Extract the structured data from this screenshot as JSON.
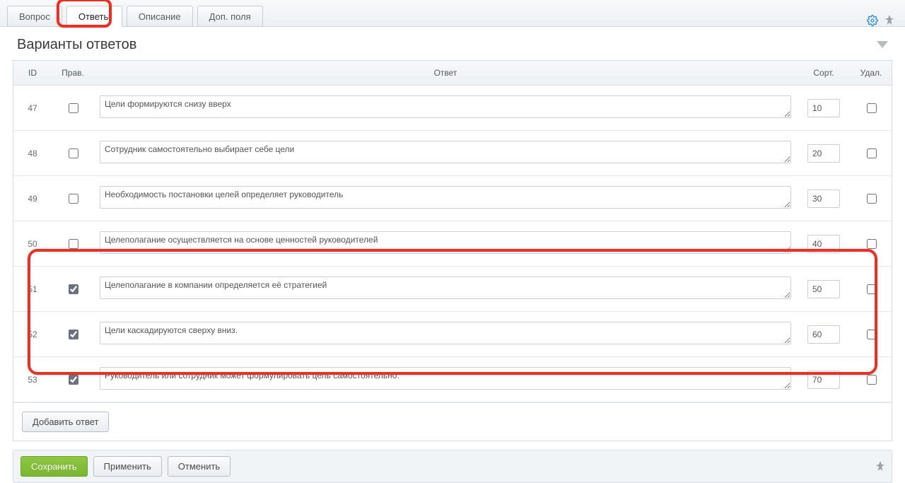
{
  "tabs": [
    {
      "label": "Вопрос",
      "active": false
    },
    {
      "label": "Ответы",
      "active": true
    },
    {
      "label": "Описание",
      "active": false
    },
    {
      "label": "Доп. поля",
      "active": false
    }
  ],
  "section_title": "Варианты ответов",
  "columns": {
    "id": "ID",
    "right": "Прав.",
    "answer": "Ответ",
    "sort": "Сорт.",
    "del": "Удал."
  },
  "rows": [
    {
      "id": "47",
      "right": false,
      "answer": "Цели формируются снизу вверх",
      "sort": "10",
      "del": false
    },
    {
      "id": "48",
      "right": false,
      "answer": "Сотрудник самостоятельно выбирает себе цели",
      "sort": "20",
      "del": false
    },
    {
      "id": "49",
      "right": false,
      "answer": "Необходимость постановки целей определяет руководитель",
      "sort": "30",
      "del": false
    },
    {
      "id": "50",
      "right": false,
      "answer": "Целеполагание осуществляется на основе ценностей руководителей",
      "sort": "40",
      "del": false
    },
    {
      "id": "51",
      "right": true,
      "answer": "Целеполагание в компании определяется её стратегией",
      "sort": "50",
      "del": false
    },
    {
      "id": "52",
      "right": true,
      "answer": "Цели каскадируются сверху вниз.",
      "sort": "60",
      "del": false
    },
    {
      "id": "53",
      "right": true,
      "answer": "Руководитель или сотрудник может формулировать цель самостоятельно.",
      "sort": "70",
      "del": false
    }
  ],
  "buttons": {
    "add": "Добавить ответ",
    "save": "Сохранить",
    "apply": "Применить",
    "cancel": "Отменить"
  },
  "colors": {
    "accent_red": "#e53227",
    "accent_green": "#86bf3a"
  }
}
